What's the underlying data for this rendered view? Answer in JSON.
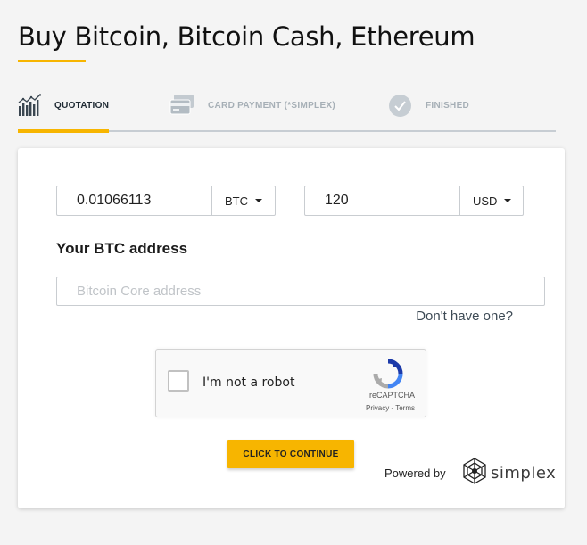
{
  "page": {
    "title": "Buy Bitcoin, Bitcoin Cash, Ethereum"
  },
  "steps": [
    {
      "label": "QUOTATION",
      "icon": "chart-icon",
      "active": true
    },
    {
      "label": "CARD PAYMENT (*SIMPLEX)",
      "icon": "credit-card-icon",
      "active": false
    },
    {
      "label": "FINISHED",
      "icon": "checkmark-circle-icon",
      "active": false
    }
  ],
  "crypto": {
    "amount": "0.01066113",
    "currency": "BTC"
  },
  "fiat": {
    "amount": "120",
    "currency": "USD"
  },
  "address": {
    "label": "Your BTC address",
    "placeholder": "Bitcoin Core address",
    "help_link": "Don't have one?"
  },
  "captcha": {
    "label": "I'm not a robot",
    "brand": "reCAPTCHA",
    "privacy": "Privacy",
    "terms": "Terms"
  },
  "continue_label": "CLICK TO CONTINUE",
  "footer": {
    "powered_by": "Powered by",
    "brand": "simplex"
  },
  "colors": {
    "accent": "#f7b500",
    "inactive": "#a6afb6",
    "background": "#f4f4f4"
  }
}
